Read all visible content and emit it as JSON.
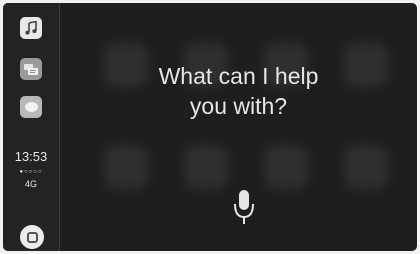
{
  "sidebar": {
    "apps": [
      {
        "name": "music",
        "icon": "music-note-icon"
      },
      {
        "name": "podcasts",
        "icon": "podcast-icon"
      },
      {
        "name": "messages",
        "icon": "speech-bubble-icon"
      }
    ],
    "status": {
      "time": "13:53",
      "signal": "●○○○○",
      "network": "4G"
    },
    "home_icon": "home-icon"
  },
  "siri": {
    "prompt_line1": "What can I help",
    "prompt_line2": "you with?",
    "mic_icon": "microphone-icon"
  },
  "colors": {
    "background": "#1e1e1e",
    "sidebar": "#232323",
    "text": "#e6e6e6"
  }
}
